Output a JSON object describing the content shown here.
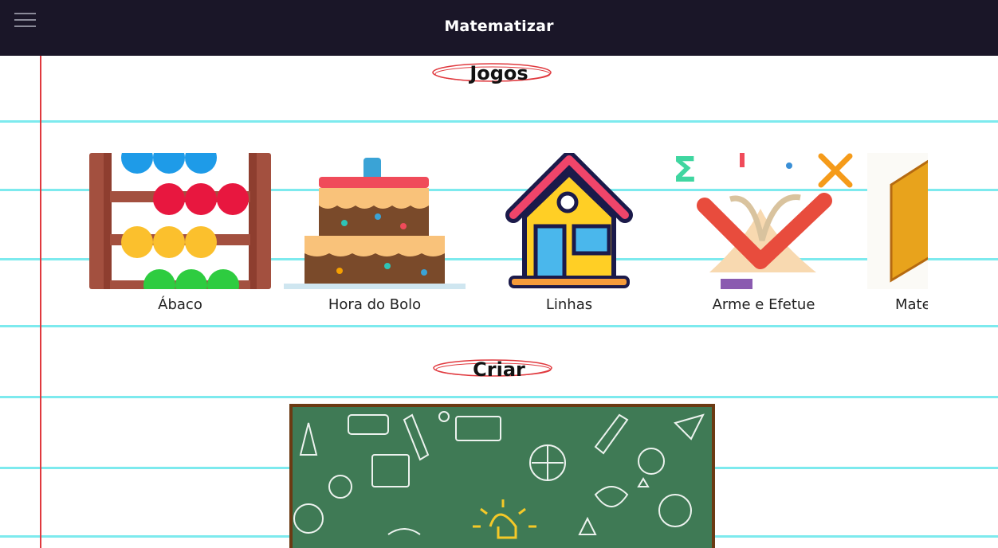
{
  "header": {
    "title": "Matematizar",
    "menu_icon": "hamburger-menu-icon"
  },
  "sections": {
    "games": {
      "title": "Jogos",
      "items": [
        {
          "label": "Ábaco",
          "icon": "abacus-icon"
        },
        {
          "label": "Hora do Bolo",
          "icon": "cake-icon"
        },
        {
          "label": "Linhas",
          "icon": "house-icon"
        },
        {
          "label": "Arme e Efetue",
          "icon": "math-book-icon"
        },
        {
          "label": "Mate",
          "icon": "book-icon"
        }
      ]
    },
    "create": {
      "title": "Criar",
      "banner": "chalkboard-doodles-image"
    }
  },
  "colors": {
    "topbar": "#1a1628",
    "notebook_lines": "#6fe8ec",
    "margin": "#e0393e",
    "board": "#3f7a55"
  }
}
